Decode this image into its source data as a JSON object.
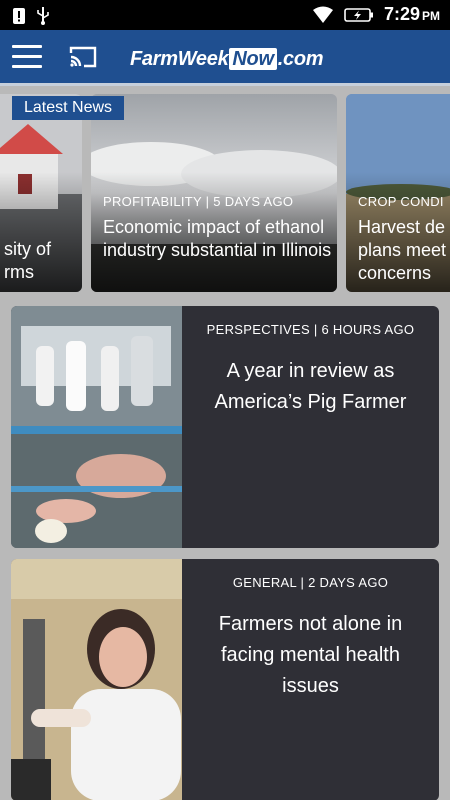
{
  "status_bar": {
    "time": "7:29",
    "ampm": "PM"
  },
  "app_bar": {
    "logo_part1": "FarmWeek",
    "logo_part2": "Now",
    "logo_part3": ".com"
  },
  "latest_news": {
    "label": "Latest News"
  },
  "carousel": [
    {
      "meta": "",
      "title": "sity of\nrms"
    },
    {
      "meta": "PROFITABILITY | 5 DAYS AGO",
      "title": "Economic impact of ethanol industry substantial in Illinois"
    },
    {
      "meta": "CROP CONDI",
      "title": "Harvest de plans meet concerns"
    }
  ],
  "articles": [
    {
      "meta": "PERSPECTIVES | 6 HOURS AGO",
      "title": "A year in review as America’s Pig Farmer"
    },
    {
      "meta": "GENERAL | 2 DAYS AGO",
      "title": "Farmers not alone in facing mental health issues"
    }
  ],
  "colors": {
    "brand": "#1f4f90",
    "card_bg": "#2f2f36",
    "page_bg": "#b9b9b9"
  }
}
